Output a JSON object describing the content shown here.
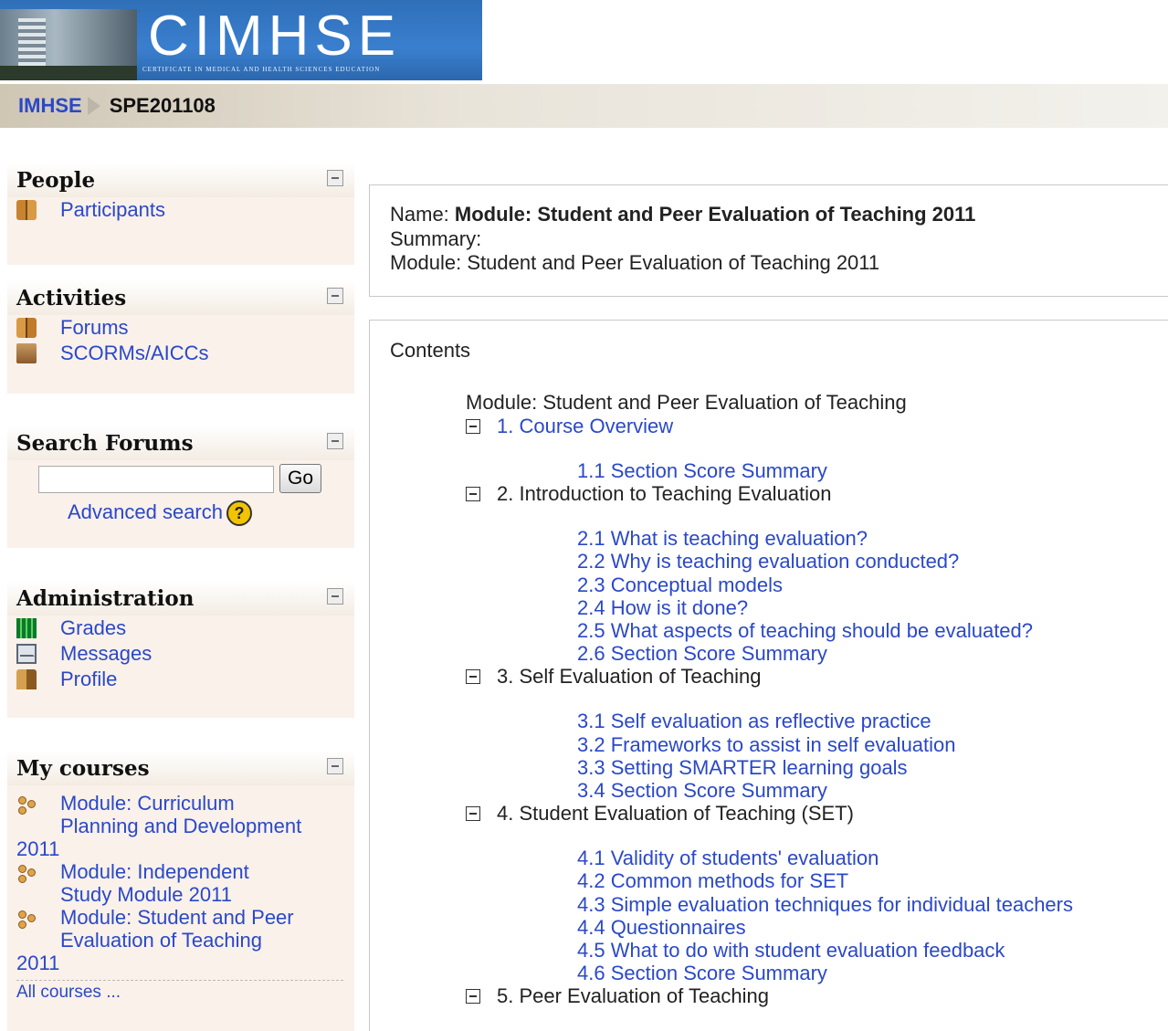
{
  "header": {
    "banner_title": "CIMHSE",
    "banner_subtitle": "CERTIFICATE IN MEDICAL AND HEALTH SCIENCES EDUCATION"
  },
  "navbar": {
    "home": "IMHSE",
    "course": "SPE201108"
  },
  "blocks": {
    "people": {
      "title": "People",
      "items": [
        {
          "label": "Participants",
          "icon": "participants-icon"
        }
      ]
    },
    "activities": {
      "title": "Activities",
      "items": [
        {
          "label": "Forums",
          "icon": "forum-icon"
        },
        {
          "label": "SCORMs/AICCs",
          "icon": "scorm-package-icon"
        }
      ]
    },
    "search_forums": {
      "title": "Search Forums",
      "go_label": "Go",
      "advanced_label": "Advanced search"
    },
    "administration": {
      "title": "Administration",
      "items": [
        {
          "label": "Grades",
          "icon": "grades-icon"
        },
        {
          "label": "Messages",
          "icon": "envelope-icon"
        },
        {
          "label": "Profile",
          "icon": "profile-icon"
        }
      ]
    },
    "my_courses": {
      "title": "My courses",
      "items": [
        {
          "line1": "Module: Curriculum",
          "line2": "Planning and Development",
          "line3": "2011"
        },
        {
          "line1": "Module: Independent",
          "line2": "Study Module 2011",
          "line3": ""
        },
        {
          "line1": "Module: Student and Peer",
          "line2": "Evaluation of Teaching",
          "line3": "2011"
        }
      ],
      "all_courses": "All courses ..."
    }
  },
  "info": {
    "name_label": "Name:",
    "name_value": "Module: Student and Peer Evaluation of Teaching 2011",
    "summary_label": "Summary:",
    "summary_value": "Module: Student and Peer Evaluation of Teaching 2011"
  },
  "contents": {
    "title": "Contents",
    "root": "Module: Student and Peer Evaluation of Teaching",
    "sections": [
      {
        "title": "1. Course Overview",
        "is_link": true,
        "items": [
          "1.1 Section Score Summary"
        ]
      },
      {
        "title": "2. Introduction to Teaching Evaluation",
        "is_link": false,
        "items": [
          "2.1 What is teaching evaluation?",
          "2.2 Why is teaching evaluation conducted?",
          "2.3 Conceptual models",
          "2.4 How is it done?",
          "2.5 What aspects of teaching should be evaluated?",
          "2.6 Section Score Summary"
        ]
      },
      {
        "title": "3. Self Evaluation of Teaching",
        "is_link": false,
        "items": [
          "3.1 Self evaluation as reflective practice",
          "3.2 Frameworks to assist in self evaluation",
          "3.3 Setting SMARTER learning goals",
          "3.4 Section Score Summary"
        ]
      },
      {
        "title": "4. Student Evaluation of Teaching (SET)",
        "is_link": false,
        "items": [
          "4.1 Validity of students' evaluation",
          "4.2 Common methods for SET",
          "4.3 Simple evaluation techniques for individual teachers",
          "4.4 Questionnaires",
          "4.5 What to do with student evaluation feedback",
          "4.6 Section Score Summary"
        ]
      },
      {
        "title": "5. Peer Evaluation of Teaching",
        "is_link": false,
        "items": []
      }
    ]
  }
}
